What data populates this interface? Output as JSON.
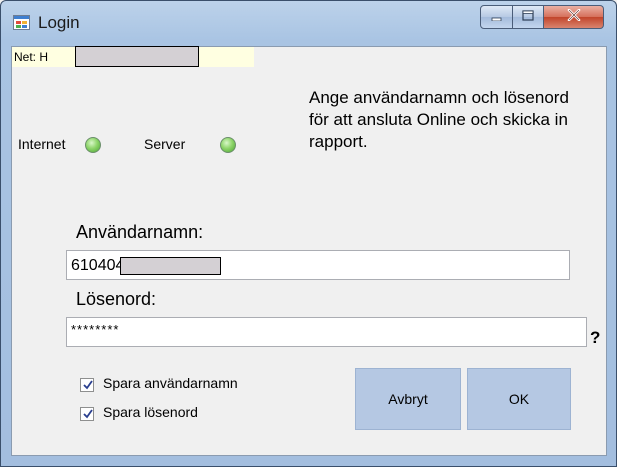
{
  "window": {
    "title": "Login"
  },
  "net": {
    "label": "Net: H"
  },
  "status": {
    "internet_label": "Internet",
    "server_label": "Server",
    "indicator_color": "#6cc24a"
  },
  "instructions": "Ange användarnamn och lösenord för att ansluta Online och skicka in rapport.",
  "form": {
    "username_label": "Användarnamn:",
    "username_value": "610404",
    "password_label": "Lösenord:",
    "password_value": "********",
    "help_text": "?"
  },
  "options": {
    "save_username_label": "Spara användarnamn",
    "save_password_label": "Spara lösenord",
    "save_username_checked": true,
    "save_password_checked": true
  },
  "buttons": {
    "cancel_label": "Avbryt",
    "ok_label": "OK"
  },
  "colors": {
    "accent": "#b5c8e3",
    "titlebar": "#a9c4e3",
    "close": "#c2452b"
  }
}
